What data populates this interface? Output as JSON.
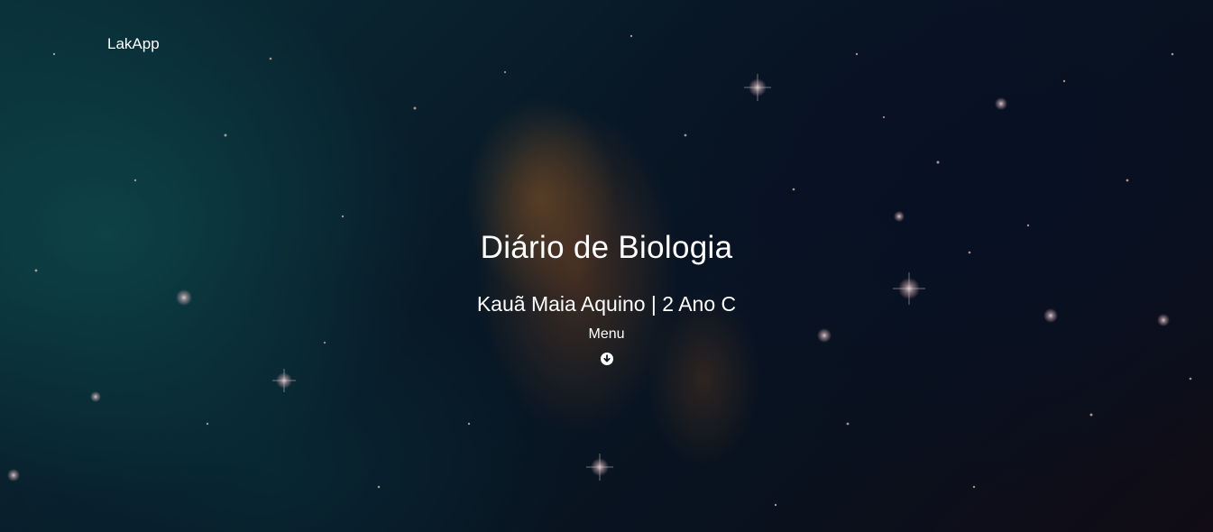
{
  "navbar": {
    "brand": "LakApp"
  },
  "hero": {
    "title": "Diário de Biologia",
    "subtitle": "Kauã Maia Aquino | 2 Ano C",
    "menu_label": "Menu",
    "scroll_icon": "arrow-circle-down-icon"
  },
  "colors": {
    "text": "#ffffff",
    "space_teal": "#0d3b45",
    "space_dark": "#0b1626",
    "nebula": "#8c5028"
  }
}
